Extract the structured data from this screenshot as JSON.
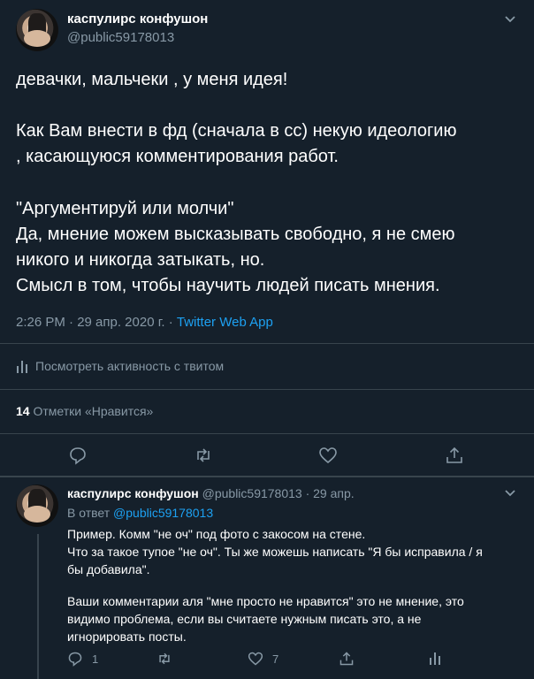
{
  "tweet": {
    "author_name": "каспулирс конфушон",
    "author_handle": "@public59178013",
    "lines": [
      "девачки, мальчеки , у меня идея!",
      "",
      "Как Вам внести в фд (сначала в сс) некую идеологию",
      ", касающуюся комментирования работ.",
      "",
      "\"Аргументируй или молчи\"",
      "Да, мнение можем высказывать свободно, я не смею",
      "никого и никогда затыкать, но.",
      "Смысл в том, чтобы научить людей писать мнения."
    ],
    "time": "2:26 PM · 29 апр. 2020 г. · ",
    "source": "Twitter Web App",
    "activity_label": "Посмотреть активность с твитом",
    "likes_count": "14",
    "likes_label": "Отметки «Нравится»"
  },
  "reply": {
    "author_name": "каспулирс конфушон",
    "meta": "@public59178013 · 29 апр.",
    "reply_prefix": "В ответ",
    "reply_handle": "@public59178013",
    "lines": [
      "Пример. Комм \"не оч\" под фото с закосом на стене.",
      "Что за такое тупое \"не оч\". Ты же можешь написать \"Я бы исправила / я",
      "бы добавила\".",
      "",
      "Ваши комментарии аля \"мне просто не нравится\" это не мнение, это",
      "видимо проблема, если вы считаете нужным писать это, а не",
      "игнорировать посты."
    ],
    "reply_count": "1",
    "like_count": "7"
  },
  "icons": {
    "chevron": "chevron-down-icon",
    "reply": "reply-icon",
    "retweet": "retweet-icon",
    "like": "heart-icon",
    "share": "share-icon",
    "analytics": "analytics-icon"
  },
  "colors": {
    "background": "#15202b",
    "muted": "#8899a6",
    "accent": "#1da1f2",
    "divider": "#38444d"
  }
}
